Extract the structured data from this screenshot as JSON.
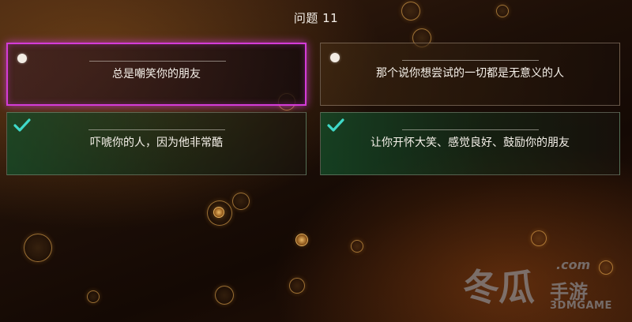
{
  "header": {
    "title": "问题 11"
  },
  "answers": [
    {
      "text": "总是嘲笑你的朋友",
      "state": "selected",
      "marker_icon": "radio-dot-icon"
    },
    {
      "text": "那个说你想尝试的一切都是无意义的人",
      "state": "default",
      "marker_icon": "radio-dot-icon"
    },
    {
      "text": "吓唬你的人，因为他非常酷",
      "state": "correct",
      "marker_icon": "checkmark-icon"
    },
    {
      "text": "让你开怀大笑、感觉良好、鼓励你的朋友",
      "state": "correct",
      "marker_icon": "checkmark-icon"
    }
  ],
  "colors": {
    "selected_border": "#d43cd8",
    "check_mark": "#3fd9c8",
    "correct_tint": "#14502a"
  },
  "watermark": {
    "main": "冬瓜",
    "sub": "手游",
    "domain": ".com",
    "en": "3DMGAME"
  }
}
